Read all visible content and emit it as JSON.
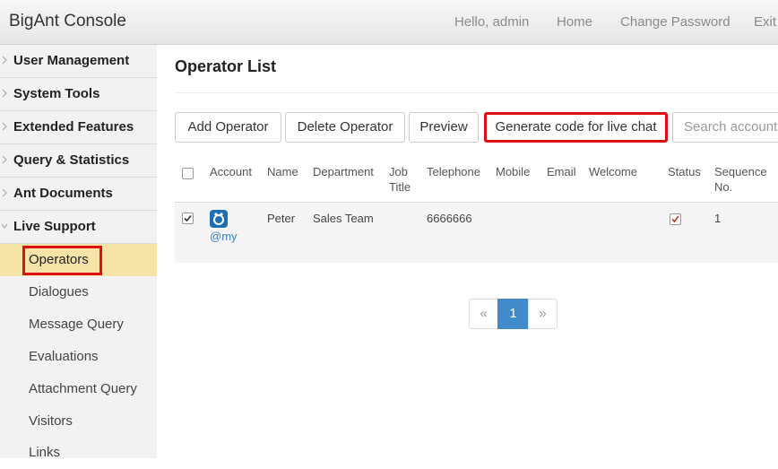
{
  "app": {
    "title": "BigAnt Console"
  },
  "topnav": {
    "greeting": "Hello, admin",
    "home": "Home",
    "change_password": "Change Password",
    "exit": "Exit"
  },
  "sidebar": {
    "sections": [
      "User Management",
      "System Tools",
      "Extended Features",
      "Query & Statistics",
      "Ant Documents",
      "Live Support"
    ],
    "live_support_items": [
      "Operators",
      "Dialogues",
      "Message Query",
      "Evaluations",
      "Attachment Query",
      "Visitors",
      "Links"
    ],
    "active_item": "Operators"
  },
  "main": {
    "title": "Operator List",
    "toolbar": {
      "add": "Add Operator",
      "delete": "Delete Operator",
      "preview": "Preview",
      "generate": "Generate code for live chat",
      "search_placeholder": "Search account"
    },
    "table": {
      "headers": {
        "account": "Account",
        "name": "Name",
        "department": "Department",
        "job_title_1": "Job",
        "job_title_2": "Title",
        "telephone": "Telephone",
        "mobile": "Mobile",
        "email": "Email",
        "welcome": "Welcome",
        "status": "Status",
        "sequence_1": "Sequence",
        "sequence_2": "No."
      },
      "rows": [
        {
          "account": "@my",
          "name": "Peter",
          "department": "Sales Team",
          "job_title": "",
          "telephone": "6666666",
          "mobile": "",
          "email": "",
          "welcome": "",
          "status_checked": true,
          "sequence": "1",
          "selected": true
        }
      ]
    },
    "pagination": {
      "prev": "«",
      "current": "1",
      "next": "»"
    }
  },
  "colors": {
    "highlight": "#dd1111",
    "active_bg": "#f5e3a8",
    "accent": "#428bca"
  },
  "icons": {
    "avatar": "bigant-logo-icon",
    "chevron": "chevron-right-icon"
  }
}
